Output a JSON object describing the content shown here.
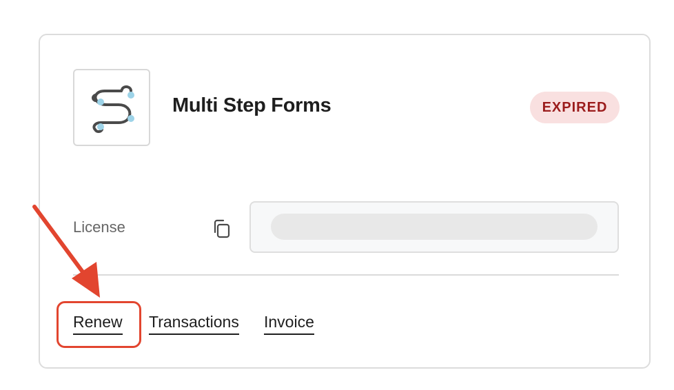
{
  "product": {
    "name": "Multi Step Forms",
    "status": "EXPIRED",
    "logo_icon": "multi-step-forms-logo-icon"
  },
  "license": {
    "label": "License",
    "copy_icon": "copy-icon"
  },
  "actions": {
    "renew": "Renew",
    "transactions": "Transactions",
    "invoice": "Invoice"
  },
  "colors": {
    "status_badge_bg": "#f9e0e0",
    "status_badge_text": "#9b1c1c",
    "annotation": "#e2452f"
  }
}
